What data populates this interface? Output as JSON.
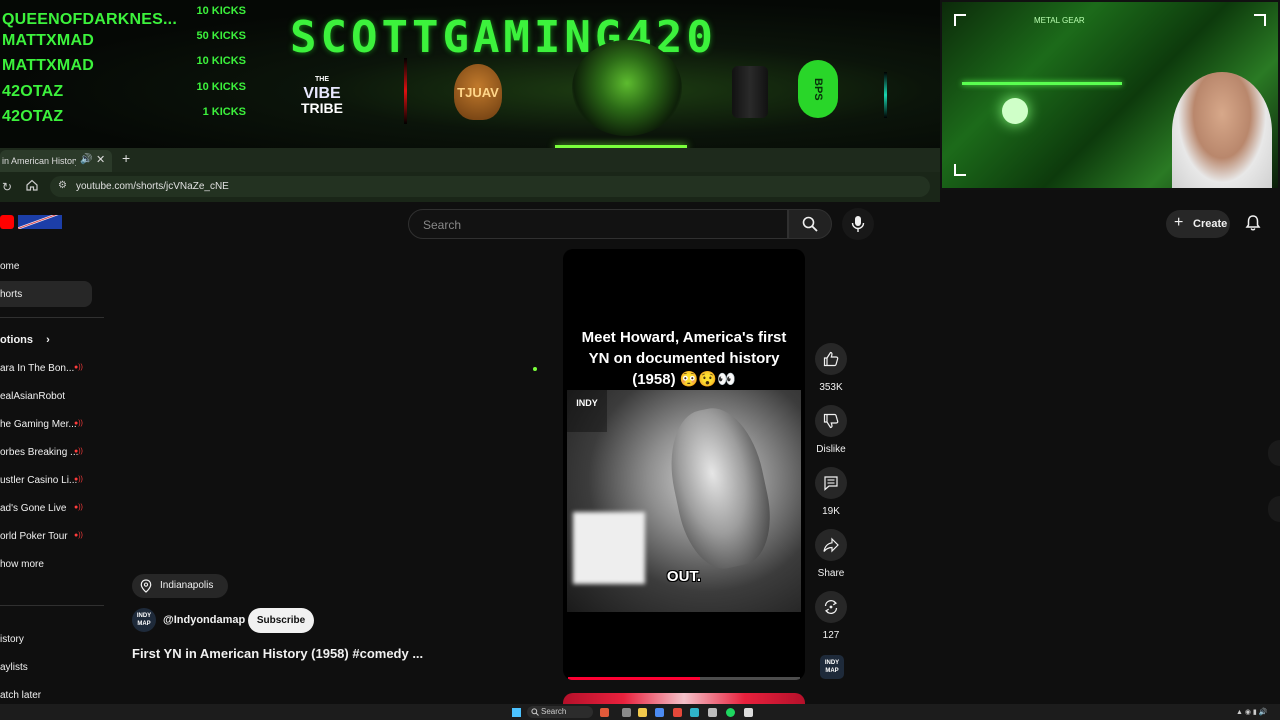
{
  "overlay": {
    "channel_title": "SCOTTGAMING420",
    "kicks": [
      {
        "name": "QUEENOFDARKNES...",
        "count": "10 KICKS"
      },
      {
        "name": "MATTXMAD",
        "count": "50 KICKS"
      },
      {
        "name": "MATTXMAD",
        "count": "10 KICKS"
      },
      {
        "name": "42OTAZ",
        "count": "10 KICKS"
      },
      {
        "name": "42OTAZ",
        "count": "1 KICKS"
      }
    ],
    "sponsors": {
      "vibe_the": "THE",
      "vibe_line1": "VIBE",
      "vibe_line2": "TRIBE",
      "tjuav": "TJUAV",
      "bps": "BPS"
    },
    "webcam_sign": "METAL GEAR"
  },
  "browser": {
    "tab_label": "in American History",
    "url": "youtube.com/shorts/jcVNaZe_cNE"
  },
  "youtube": {
    "search_placeholder": "Search",
    "create_label": "Create",
    "sidebar": {
      "home": "ome",
      "shorts": "horts",
      "subscriptions_header": "otions",
      "channels": [
        "ara In The Bon...",
        "ealAsianRobot",
        "he Gaming Mer...",
        "orbes Breaking ...",
        "ustler Casino Li...",
        "ad's Gone Live",
        "orld Poker Tour"
      ],
      "show_more": "how more",
      "history": "istory",
      "playlists": "aylists",
      "watch_later": "atch later"
    },
    "short": {
      "caption": "Meet Howard, America's first YN on documented history (1958) 😳😯👀",
      "subtitle": "OUT.",
      "frame_logo": "INDY",
      "progress": 0.57,
      "location": "Indianapolis",
      "handle": "@Indyondamap",
      "subscribe_label": "Subscribe",
      "title": "First YN in American History (1958) #comedy ...",
      "avatar_text": "INDY MAP"
    },
    "actions": {
      "likes": "353K",
      "dislike": "Dislike",
      "comments": "19K",
      "share": "Share",
      "remix": "127"
    }
  },
  "taskbar": {
    "search_label": "Search"
  },
  "colors": {
    "overlay_green": "#3cf23c",
    "youtube_red": "#ff0000",
    "progress_red": "#ff0033"
  }
}
